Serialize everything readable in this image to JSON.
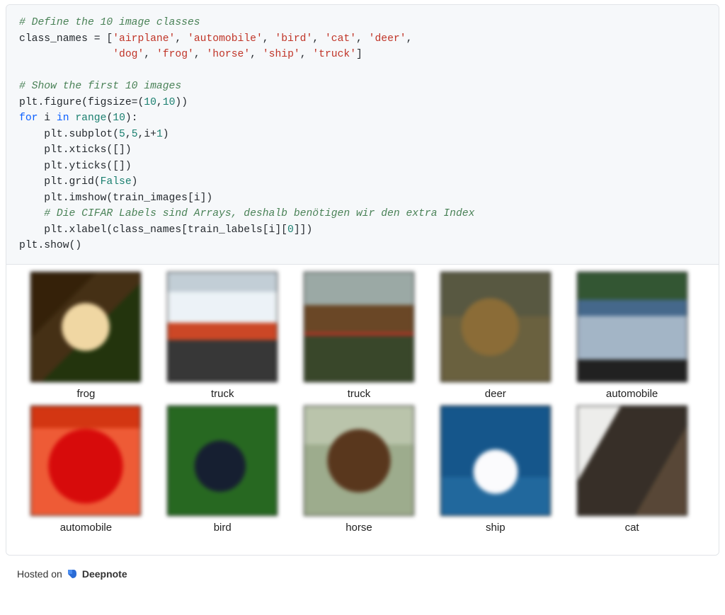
{
  "code": {
    "comment1": "# Define the 10 image classes",
    "class_names_var": "class_names = [",
    "class_names_row1": [
      "'airplane'",
      "'automobile'",
      "'bird'",
      "'cat'",
      "'deer'"
    ],
    "class_names_row2": [
      "'dog'",
      "'frog'",
      "'horse'",
      "'ship'",
      "'truck'"
    ],
    "comment2": "# Show the first 10 images",
    "line_figure_a": "plt.figure(figsize=(",
    "line_figure_n1": "10",
    "line_figure_c": ",",
    "line_figure_n2": "10",
    "line_figure_b": "))",
    "for_kw": "for",
    "for_var": " i ",
    "in_kw": "in",
    "range_kw": " range",
    "range_open": "(",
    "range_n": "10",
    "range_close": "):",
    "subplot_a": "    plt.subplot(",
    "subplot_n1": "5",
    "subplot_c1": ",",
    "subplot_n2": "5",
    "subplot_c2": ",i+",
    "subplot_n3": "1",
    "subplot_b": ")",
    "xticks": "    plt.xticks([])",
    "yticks": "    plt.yticks([])",
    "grid_a": "    plt.grid(",
    "grid_false": "False",
    "grid_b": ")",
    "imshow": "    plt.imshow(train_images[i])",
    "comment3": "    # Die CIFAR Labels sind Arrays, deshalb benötigen wir den extra Index",
    "xlabel_a": "    plt.xlabel(class_names[train_labels[i][",
    "xlabel_n": "0",
    "xlabel_b": "]])",
    "show": "plt.show()"
  },
  "output": {
    "items": [
      {
        "label": "frog",
        "class": "th-frog"
      },
      {
        "label": "truck",
        "class": "th-truck1"
      },
      {
        "label": "truck",
        "class": "th-truck2"
      },
      {
        "label": "deer",
        "class": "th-deer"
      },
      {
        "label": "automobile",
        "class": "th-auto1"
      },
      {
        "label": "automobile",
        "class": "th-auto2"
      },
      {
        "label": "bird",
        "class": "th-bird"
      },
      {
        "label": "horse",
        "class": "th-horse"
      },
      {
        "label": "ship",
        "class": "th-ship"
      },
      {
        "label": "cat",
        "class": "th-cat"
      }
    ]
  },
  "footer": {
    "hosted": "Hosted on",
    "brand": "Deepnote"
  }
}
